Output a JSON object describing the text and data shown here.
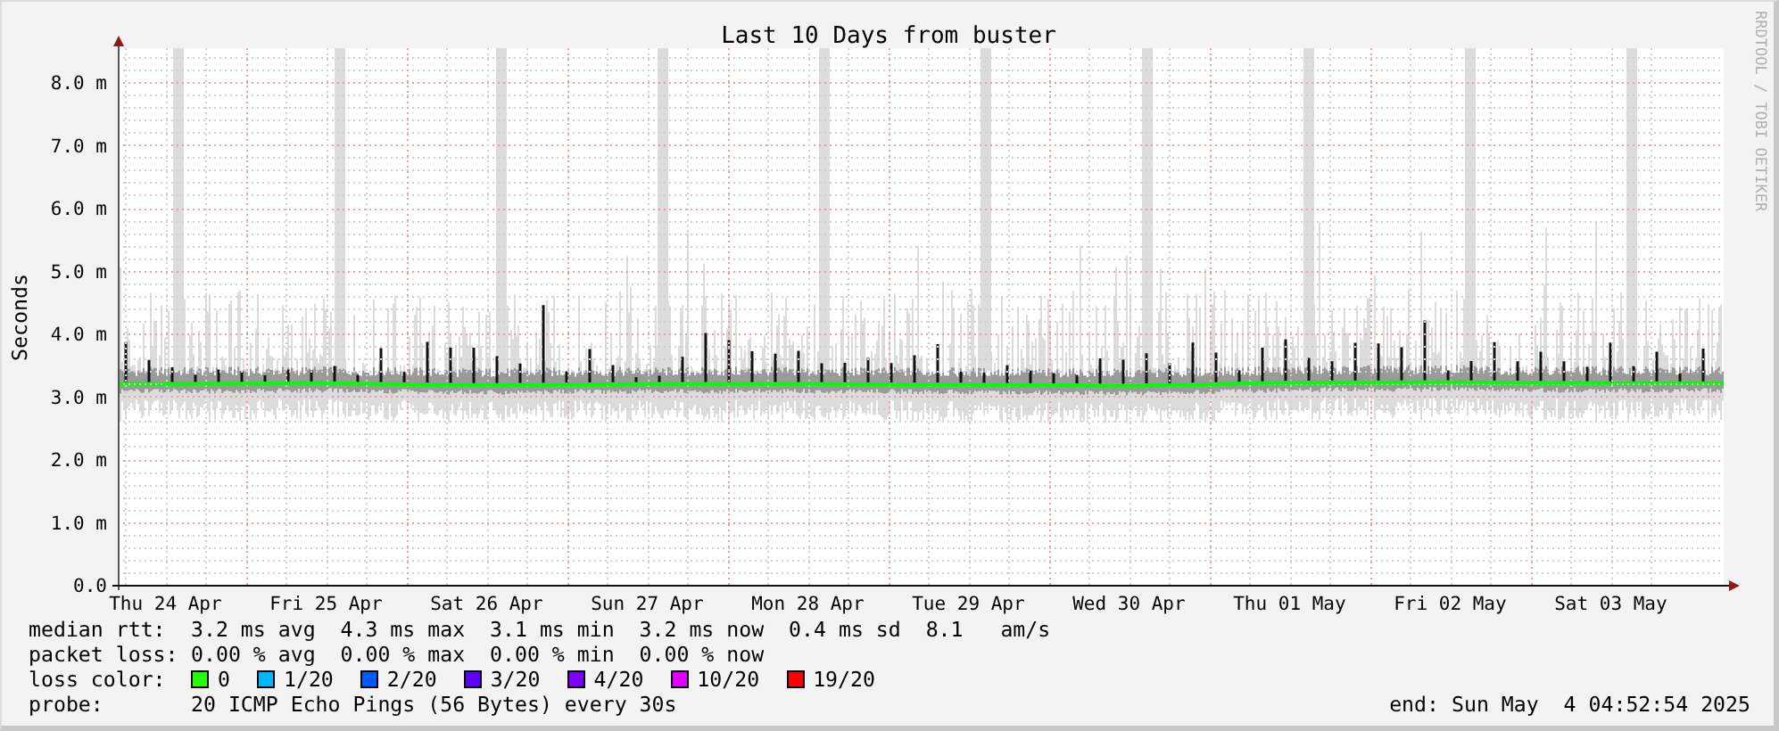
{
  "graph": {
    "credit": "RRDTOOL / TOBI OETIKER",
    "chart_data": {
      "type": "line",
      "title": "Last 10 Days from buster",
      "ylabel": "Seconds",
      "grid": true,
      "ylim": [
        0,
        8.54
      ],
      "yticks": [
        {
          "value": 0,
          "label": "0.0"
        },
        {
          "value": 1,
          "label": "1.0 m"
        },
        {
          "value": 2,
          "label": "2.0 m"
        },
        {
          "value": 3,
          "label": "3.0 m"
        },
        {
          "value": 4,
          "label": "4.0 m"
        },
        {
          "value": 5,
          "label": "5.0 m"
        },
        {
          "value": 6,
          "label": "6.0 m"
        },
        {
          "value": 7,
          "label": "7.0 m"
        },
        {
          "value": 8,
          "label": "8.0 m"
        }
      ],
      "categories": [
        "Thu 24 Apr",
        "Fri 25 Apr",
        "Sat 26 Apr",
        "Sun 27 Apr",
        "Mon 28 Apr",
        "Tue 29 Apr",
        "Wed 30 Apr",
        "Thu 01 May",
        "Fri 02 May",
        "Sat 03 May"
      ],
      "series": [
        {
          "color": "#00ff00",
          "values": [
            3.2,
            3.21,
            3.18,
            3.2,
            3.2,
            3.19,
            3.17,
            3.22,
            3.23,
            3.21
          ]
        }
      ]
    }
  },
  "legend": {
    "rows": [
      {
        "kind": "stats",
        "label": "median rtt:",
        "text": "3.2 ms avg  4.3 ms max  3.1 ms min  3.2 ms now  0.4 ms sd  8.1   am/s"
      },
      {
        "kind": "stats",
        "label": "packet loss:",
        "text": "0.00 % avg  0.00 % max  0.00 % min  0.00 % now"
      },
      {
        "kind": "colors",
        "label": "loss color:",
        "loss_colors": [
          {
            "label": "0",
            "color": "#26ff00"
          },
          {
            "label": "1/20",
            "color": "#00b8ff"
          },
          {
            "label": "2/20",
            "color": "#0059ff"
          },
          {
            "label": "3/20",
            "color": "#5e00ff"
          },
          {
            "label": "4/20",
            "color": "#7e00ff"
          },
          {
            "label": "10/20",
            "color": "#dd00ff"
          },
          {
            "label": "19/20",
            "color": "#ff0000"
          }
        ]
      },
      {
        "kind": "probe",
        "label": "probe:",
        "text": "20 ICMP Echo Pings (56 Bytes) every 30s",
        "end": "end: Sun May  4 04:52:54 2025"
      }
    ]
  }
}
